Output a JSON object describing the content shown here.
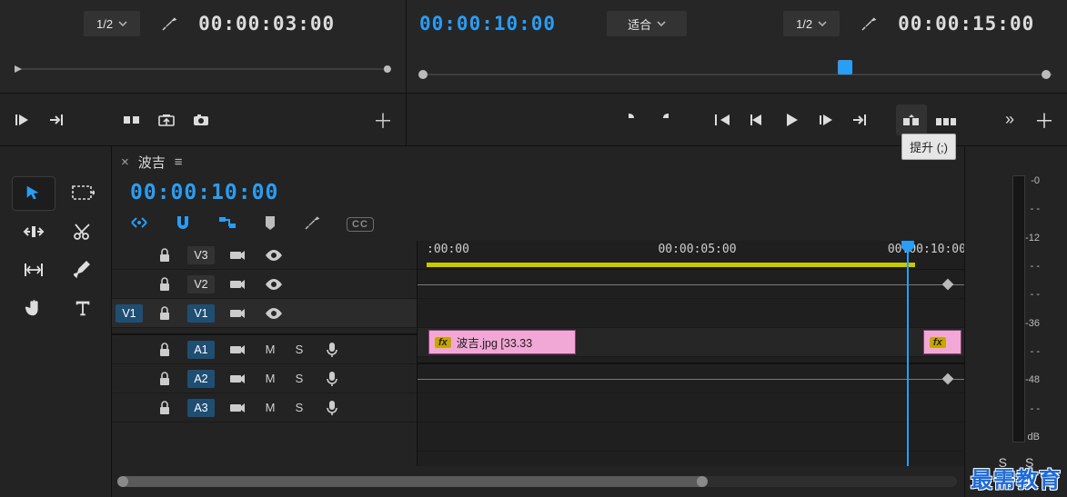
{
  "source_monitor": {
    "resolution_label": "1/2",
    "timecode": "00:00:03:00"
  },
  "program_monitor": {
    "playhead_timecode": "00:00:10:00",
    "zoom_label": "适合",
    "resolution_label": "1/2",
    "duration_timecode": "00:00:15:00",
    "tooltip": "提升 (;)"
  },
  "timeline": {
    "sequence_name": "波吉",
    "close_glyph": "×",
    "menu_glyph": "≡",
    "playhead_timecode": "00:00:10:00",
    "cc_label": "CC",
    "ruler_labels": [
      ":00:00",
      "00:00:05:00",
      "00:00:10:00"
    ],
    "tracks": {
      "video": [
        {
          "label": "V3"
        },
        {
          "label": "V2"
        },
        {
          "label": "V1",
          "source_label": "V1",
          "selected": true
        }
      ],
      "audio": [
        {
          "label": "A1",
          "mute": "M",
          "solo": "S"
        },
        {
          "label": "A2",
          "mute": "M",
          "solo": "S"
        },
        {
          "label": "A3",
          "mute": "M",
          "solo": "S"
        }
      ]
    },
    "clips": [
      {
        "track": "V1",
        "label": "波吉.jpg [33.33",
        "fx": "fx",
        "start_pct": 2,
        "width_pct": 27
      },
      {
        "track": "V1",
        "label": "",
        "fx": "fx",
        "start_pct": 92.5,
        "width_pct": 7
      }
    ]
  },
  "meters": {
    "scale": [
      "-0",
      "- -",
      "-12",
      "- -",
      "- -",
      "-36",
      "- -",
      "-48",
      "- -",
      "dB"
    ],
    "solo_label": "S"
  },
  "watermark": "最需教育"
}
